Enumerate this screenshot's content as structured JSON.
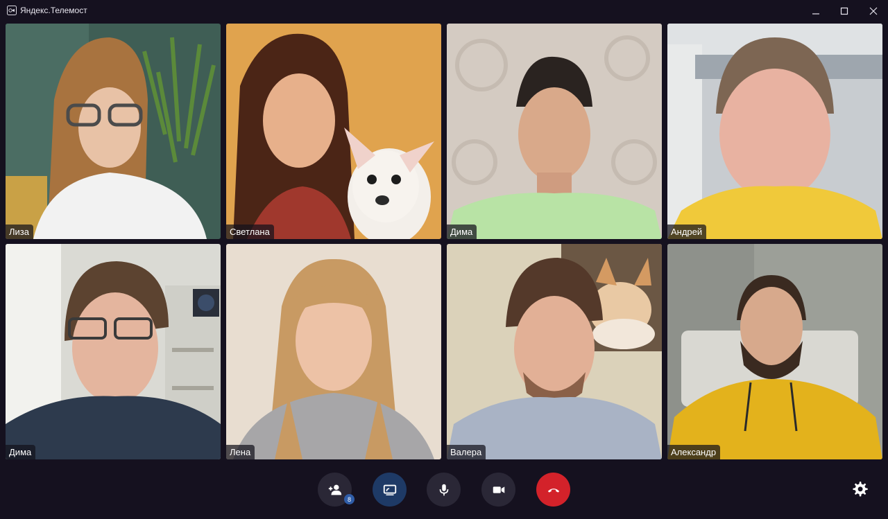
{
  "window": {
    "title": "Яндекс.Телемост",
    "icon": "telemost-app-icon",
    "controls": [
      "minimize-icon",
      "maximize-icon",
      "close-icon"
    ]
  },
  "participants": [
    {
      "name": "Лиза",
      "bg_color": "#4e6f63"
    },
    {
      "name": "Светлана",
      "bg_color": "#e0a34e"
    },
    {
      "name": "Дима",
      "bg_color": "#cfc6bd"
    },
    {
      "name": "Андрей",
      "bg_color": "#c9cdd0"
    },
    {
      "name": "Дима",
      "bg_color": "#d8d8d2"
    },
    {
      "name": "Лена",
      "bg_color": "#e6dccf"
    },
    {
      "name": "Валера",
      "bg_color": "#d9cfb6"
    },
    {
      "name": "Александр",
      "bg_color": "#9fa39c"
    }
  ],
  "toolbar": {
    "invite": {
      "icon": "add-person-icon",
      "badge": "8"
    },
    "share": {
      "icon": "screen-share-icon"
    },
    "mic": {
      "icon": "microphone-icon"
    },
    "camera": {
      "icon": "camera-icon"
    },
    "hangup": {
      "icon": "hangup-icon"
    },
    "settings": {
      "icon": "gear-icon"
    }
  },
  "colors": {
    "background": "#15111f",
    "button": "#2a2736",
    "share_button": "#1e3a66",
    "hangup_button": "#d3222a",
    "badge": "#2f5da8"
  }
}
